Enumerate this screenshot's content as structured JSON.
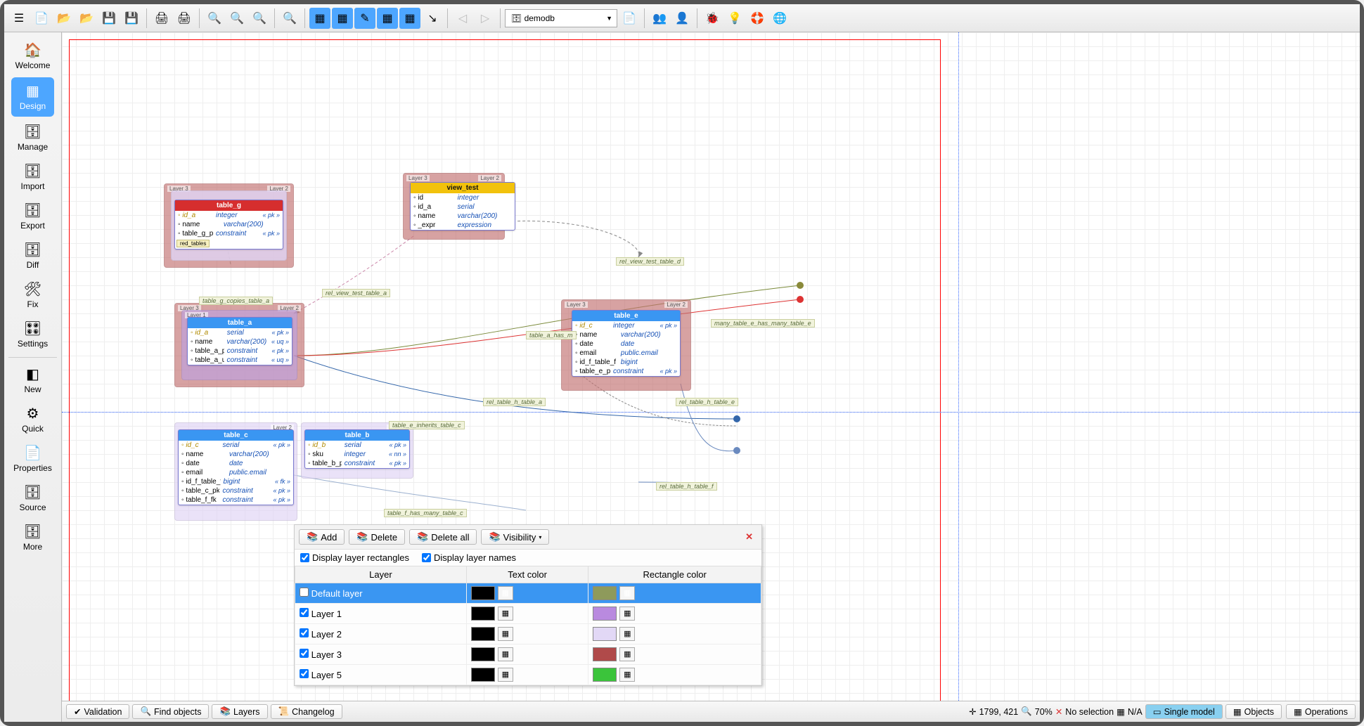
{
  "toolbar": {
    "combo_db": "demodb"
  },
  "sidebar": [
    {
      "label": "Welcome"
    },
    {
      "label": "Design"
    },
    {
      "label": "Manage"
    },
    {
      "label": "Import"
    },
    {
      "label": "Export"
    },
    {
      "label": "Diff"
    },
    {
      "label": "Fix"
    },
    {
      "label": "Settings"
    },
    {
      "label": "New"
    },
    {
      "label": "Quick"
    },
    {
      "label": "Properties"
    },
    {
      "label": "Source"
    },
    {
      "label": "More"
    }
  ],
  "layers_panel": {
    "buttons": {
      "add": "Add",
      "delete": "Delete",
      "delete_all": "Delete all",
      "visibility": "Visibility"
    },
    "checks": {
      "rects": "Display layer rectangles",
      "names": "Display layer names"
    },
    "columns": {
      "layer": "Layer",
      "text": "Text color",
      "rect": "Rectangle color"
    },
    "rows": [
      {
        "name": "Default layer",
        "txt": "#000000",
        "rect": "#8e9a5b",
        "selected": true,
        "checked": false
      },
      {
        "name": "Layer 1",
        "txt": "#000000",
        "rect": "#b98adf",
        "checked": true
      },
      {
        "name": "Layer 2",
        "txt": "#000000",
        "rect": "#e2d8f6",
        "checked": true
      },
      {
        "name": "Layer 3",
        "txt": "#000000",
        "rect": "#b04a4a",
        "checked": true
      },
      {
        "name": "Layer 5",
        "txt": "#000000",
        "rect": "#3bc43b",
        "checked": true
      }
    ]
  },
  "status": {
    "validation": "Validation",
    "find": "Find objects",
    "layers": "Layers",
    "changelog": "Changelog",
    "coords": "1799, 421",
    "zoom": "70%",
    "sel": "No selection",
    "na": "N/A",
    "mode": "Single model",
    "objects": "Objects",
    "operations": "Operations"
  },
  "relations": {
    "g_copies_a": "table_g_copies_table_a",
    "view_a": "rel_view_test_table_a",
    "view_d": "rel_view_test_table_d",
    "e_many_e": "many_table_e_has_many_table_e",
    "a_has_m": "table_a_has_m",
    "h_a": "rel_table_h_table_a",
    "h_e": "rel_table_h_table_e",
    "h_f": "rel_table_h_table_f",
    "e_inh_c": "table_e_inherits_table_c",
    "f_many_c": "table_f_has_many_table_c"
  },
  "layer_tags": {
    "l1": "Layer 1",
    "l2": "Layer 2",
    "l3": "Layer 3"
  },
  "tables": {
    "table_g": {
      "title": "table_g",
      "rows": [
        {
          "c1": "id_a",
          "c2": "integer",
          "c3": "« pk »",
          "k": true
        },
        {
          "c1": "name",
          "c2": "varchar(200)"
        },
        {
          "c1": "table_g_pk",
          "c2": "constraint",
          "c3": "« pk »"
        }
      ],
      "tag": "red_tables"
    },
    "view_test": {
      "title": "view_test",
      "rows": [
        {
          "c1": "id",
          "c2": "integer"
        },
        {
          "c1": "id_a",
          "c2": "serial"
        },
        {
          "c1": "name",
          "c2": "varchar(200)"
        },
        {
          "c1": "_expr",
          "c2": "expression"
        }
      ]
    },
    "table_a": {
      "title": "table_a",
      "rows": [
        {
          "c1": "id_a",
          "c2": "serial",
          "c3": "« pk »",
          "k": true
        },
        {
          "c1": "name",
          "c2": "varchar(200)",
          "c3": "« uq »"
        },
        {
          "c1": "table_a_pk",
          "c2": "constraint",
          "c3": "« pk »"
        },
        {
          "c1": "table_a_uq",
          "c2": "constraint",
          "c3": "« uq »"
        }
      ]
    },
    "table_e": {
      "title": "table_e",
      "rows": [
        {
          "c1": "id_c",
          "c2": "integer",
          "c3": "« pk »",
          "k": true
        },
        {
          "c1": "name",
          "c2": "varchar(200)"
        },
        {
          "c1": "date",
          "c2": "date"
        },
        {
          "c1": "email",
          "c2": "public.email"
        },
        {
          "c1": "id_f_table_f",
          "c2": "bigint"
        },
        {
          "c1": "table_e_pk",
          "c2": "constraint",
          "c3": "« pk »"
        }
      ]
    },
    "table_c": {
      "title": "table_c",
      "rows": [
        {
          "c1": "id_c",
          "c2": "serial",
          "c3": "« pk »",
          "k": true
        },
        {
          "c1": "name",
          "c2": "varchar(200)"
        },
        {
          "c1": "date",
          "c2": "date"
        },
        {
          "c1": "email",
          "c2": "public.email"
        },
        {
          "c1": "id_f_table_f",
          "c2": "bigint",
          "c3": "« fk »"
        },
        {
          "c1": "table_c_pk",
          "c2": "constraint",
          "c3": "« pk »"
        },
        {
          "c1": "table_f_fk",
          "c2": "constraint",
          "c3": "« pk »"
        }
      ]
    },
    "table_b": {
      "title": "table_b",
      "rows": [
        {
          "c1": "id_b",
          "c2": "serial",
          "c3": "« pk »",
          "k": true
        },
        {
          "c1": "sku",
          "c2": "integer",
          "c3": "« nn »"
        },
        {
          "c1": "table_b_pk",
          "c2": "constraint",
          "c3": "« pk »"
        }
      ]
    }
  }
}
